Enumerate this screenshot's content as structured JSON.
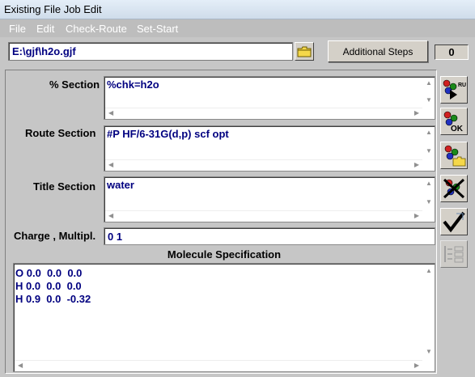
{
  "window": {
    "title": "Existing File Job Edit"
  },
  "menu": {
    "items": [
      "File",
      "Edit",
      "Check-Route",
      "Set-Start"
    ]
  },
  "file": {
    "path": "E:\\gjf\\h2o.gjf"
  },
  "toolbar": {
    "additional_steps_label": "Additional Steps",
    "step_count": "0"
  },
  "sections": {
    "percent": {
      "label": "% Section",
      "value": "%chk=h2o"
    },
    "route": {
      "label": "Route Section",
      "value": "#P HF/6-31G(d,p) scf opt"
    },
    "title": {
      "label": "Title Section",
      "value": "water"
    },
    "charge": {
      "label": "Charge , Multipl.",
      "value": "0 1"
    }
  },
  "molecule": {
    "header": "Molecule Specification",
    "text": "O 0.0  0.0  0.0\nH 0.0  0.0  0.0\nH 0.9  0.0  -0.32"
  },
  "side_buttons": [
    {
      "name": "run-icon",
      "glyph": "RUN"
    },
    {
      "name": "ok-icon",
      "glyph": "OK"
    },
    {
      "name": "save-icon",
      "glyph": ""
    },
    {
      "name": "cancel-icon",
      "glyph": ""
    },
    {
      "name": "check-icon",
      "glyph": ""
    },
    {
      "name": "steps-icon",
      "glyph": ""
    }
  ]
}
